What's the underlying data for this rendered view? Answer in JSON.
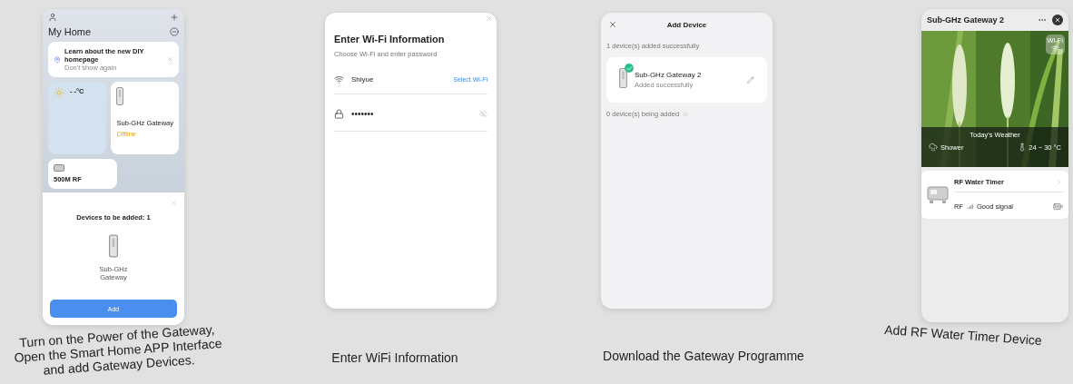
{
  "steps": [
    {
      "kind": "home",
      "caption": "Turn on the Power of the Gateway, Open the Smart Home APP Interface and add Gateway Devices.",
      "screen": {
        "title": "My Home",
        "banner": {
          "title": "Learn about the new DIY homepage",
          "subtitle": "Don't show again"
        },
        "weather": {
          "temperature": "- -°C"
        },
        "devices": [
          {
            "name": "Sub-GHz Gateway",
            "status": "Offline"
          },
          {
            "name": "500M RF"
          }
        ],
        "sheet": {
          "title": "Devices to be added: 1",
          "device": "Sub-GHz Gateway",
          "button": "Add"
        }
      }
    },
    {
      "kind": "wifi",
      "caption": "Enter WiFi Information",
      "screen": {
        "title": "Enter Wi-Fi Information",
        "subtitle": "Choose Wi-Fi and enter password",
        "network": "Shiyue",
        "link": "Select Wi-Fi",
        "password": "•••••••"
      }
    },
    {
      "kind": "added",
      "caption": "Download the Gateway Programme",
      "screen": {
        "title": "Add Device",
        "success_label": "1 device(s) added successfully",
        "device": {
          "name": "Sub-GHz Gateway 2",
          "status": "Added successfully"
        },
        "pending_label": "0 device(s) being added"
      }
    },
    {
      "kind": "gateway",
      "caption": "Add RF Water Timer Device",
      "screen": {
        "title": "Sub-GHz Gateway 2",
        "wifi_badge": "Wi-Fi",
        "weather": {
          "title": "Today's Weather",
          "condition": "Shower",
          "temperature": "24 ~ 30 °C"
        },
        "device": {
          "name": "RF Water Timer",
          "protocol": "RF",
          "signal": "Good signal"
        }
      }
    }
  ]
}
